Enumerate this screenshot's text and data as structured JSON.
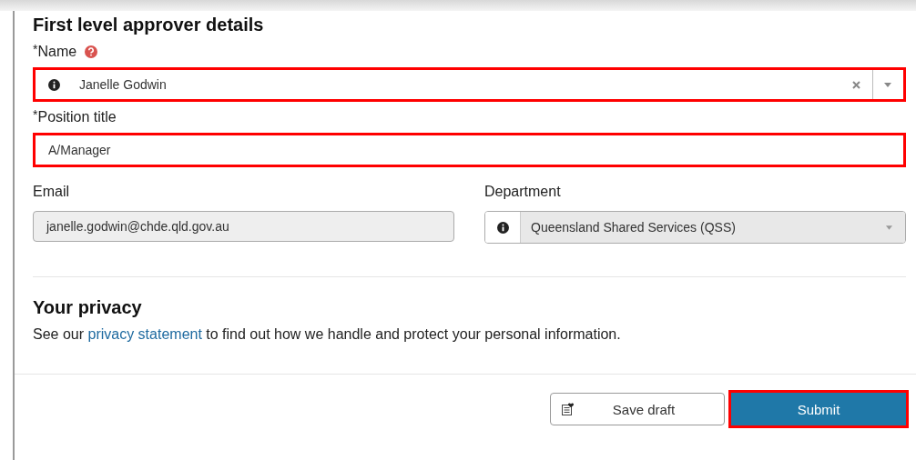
{
  "heading": "First level approver details",
  "name_field": {
    "label": "Name",
    "required_mark": "*",
    "value": "Janelle Godwin",
    "highlighted": true
  },
  "position_field": {
    "label": "Position title",
    "required_mark": "*",
    "value": "A/Manager",
    "highlighted": true
  },
  "email_field": {
    "label": "Email",
    "value": "janelle.godwin@chde.qld.gov.au",
    "disabled": true
  },
  "department_field": {
    "label": "Department",
    "value": "Queensland Shared Services (QSS)",
    "disabled": true
  },
  "privacy": {
    "heading": "Your privacy",
    "before": "See our ",
    "link": "privacy statement",
    "after": " to find out how we handle and protect your personal information."
  },
  "buttons": [
    {
      "label": "Save draft",
      "kind": "secondary",
      "highlighted": false
    },
    {
      "label": "Submit",
      "kind": "primary",
      "highlighted": true
    }
  ]
}
